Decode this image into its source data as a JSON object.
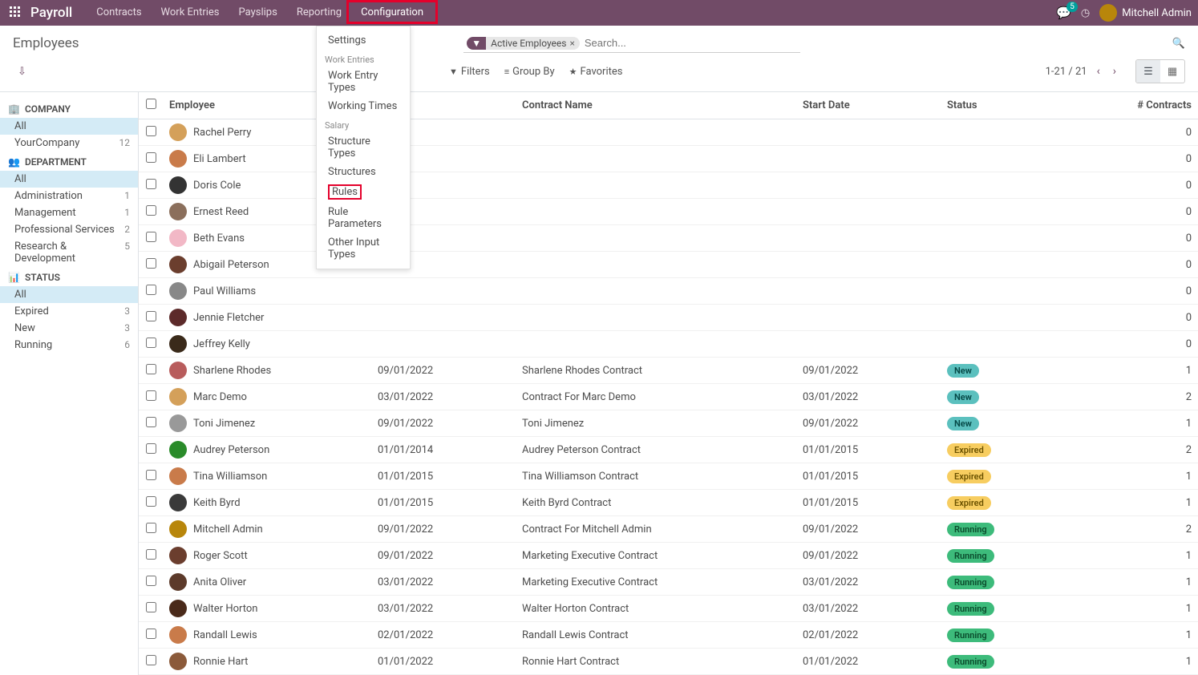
{
  "topnav": {
    "brand": "Payroll",
    "items": [
      "Contracts",
      "Work Entries",
      "Payslips",
      "Reporting",
      "Configuration"
    ],
    "chat_count": "5",
    "user_name": "Mitchell Admin"
  },
  "dropdown": {
    "settings": "Settings",
    "sections": [
      {
        "title": "Work Entries",
        "items": [
          "Work Entry Types",
          "Working Times"
        ]
      },
      {
        "title": "Salary",
        "items": [
          "Structure Types",
          "Structures",
          "Rules",
          "Rule Parameters",
          "Other Input Types"
        ]
      }
    ]
  },
  "breadcrumb": "Employees",
  "search": {
    "facet_label": "Active Employees",
    "placeholder": "Search..."
  },
  "toolbar": {
    "filters": "Filters",
    "group_by": "Group By",
    "favorites": "Favorites",
    "pager": "1-21 / 21"
  },
  "sidebar": {
    "sections": [
      {
        "title": "COMPANY",
        "icon": "🏢",
        "items": [
          {
            "label": "All",
            "count": "",
            "active": true
          },
          {
            "label": "YourCompany",
            "count": "12"
          }
        ]
      },
      {
        "title": "DEPARTMENT",
        "icon": "👥",
        "items": [
          {
            "label": "All",
            "count": "",
            "active": true
          },
          {
            "label": "Administration",
            "count": "1"
          },
          {
            "label": "Management",
            "count": "1"
          },
          {
            "label": "Professional Services",
            "count": "2"
          },
          {
            "label": "Research & Development",
            "count": "5"
          }
        ]
      },
      {
        "title": "STATUS",
        "icon": "📊",
        "items": [
          {
            "label": "All",
            "count": "",
            "active": true
          },
          {
            "label": "Expired",
            "count": "3"
          },
          {
            "label": "New",
            "count": "3"
          },
          {
            "label": "Running",
            "count": "6"
          }
        ]
      }
    ]
  },
  "columns": {
    "employee": "Employee",
    "contract_start": "",
    "contract_name": "Contract Name",
    "start_date": "Start Date",
    "status": "Status",
    "contracts": "# Contracts"
  },
  "rows": [
    {
      "employee": "Rachel Perry",
      "ref": "",
      "contract": "",
      "start": "",
      "status": "",
      "count": "0",
      "avc": "#d4a05a"
    },
    {
      "employee": "Eli Lambert",
      "ref": "",
      "contract": "",
      "start": "",
      "status": "",
      "count": "0",
      "avc": "#c97b4a"
    },
    {
      "employee": "Doris Cole",
      "ref": "",
      "contract": "",
      "start": "",
      "status": "",
      "count": "0",
      "avc": "#333"
    },
    {
      "employee": "Ernest Reed",
      "ref": "",
      "contract": "",
      "start": "",
      "status": "",
      "count": "0",
      "avc": "#8b6f5c"
    },
    {
      "employee": "Beth Evans",
      "ref": "",
      "contract": "",
      "start": "",
      "status": "",
      "count": "0",
      "avc": "#f2b8c6"
    },
    {
      "employee": "Abigail Peterson",
      "ref": "",
      "contract": "",
      "start": "",
      "status": "",
      "count": "0",
      "avc": "#6b3e2e"
    },
    {
      "employee": "Paul Williams",
      "ref": "",
      "contract": "",
      "start": "",
      "status": "",
      "count": "0",
      "avc": "#888"
    },
    {
      "employee": "Jennie Fletcher",
      "ref": "",
      "contract": "",
      "start": "",
      "status": "",
      "count": "0",
      "avc": "#5c2a2a"
    },
    {
      "employee": "Jeffrey Kelly",
      "ref": "",
      "contract": "",
      "start": "",
      "status": "",
      "count": "0",
      "avc": "#3a2a1a"
    },
    {
      "employee": "Sharlene Rhodes",
      "ref": "09/01/2022",
      "contract": "Sharlene Rhodes Contract",
      "start": "09/01/2022",
      "status": "New",
      "count": "1",
      "avc": "#b85c5c"
    },
    {
      "employee": "Marc Demo",
      "ref": "03/01/2022",
      "contract": "Contract For Marc Demo",
      "start": "03/01/2022",
      "status": "New",
      "count": "2",
      "avc": "#d4a05a"
    },
    {
      "employee": "Toni Jimenez",
      "ref": "09/01/2022",
      "contract": "Toni Jimenez",
      "start": "09/01/2022",
      "status": "New",
      "count": "1",
      "avc": "#999"
    },
    {
      "employee": "Audrey Peterson",
      "ref": "01/01/2014",
      "contract": "Audrey Peterson Contract",
      "start": "01/01/2015",
      "status": "Expired",
      "count": "2",
      "avc": "#2a8b2a"
    },
    {
      "employee": "Tina Williamson",
      "ref": "01/01/2015",
      "contract": "Tina Williamson Contract",
      "start": "01/01/2015",
      "status": "Expired",
      "count": "1",
      "avc": "#c97b4a"
    },
    {
      "employee": "Keith Byrd",
      "ref": "01/01/2015",
      "contract": "Keith Byrd Contract",
      "start": "01/01/2015",
      "status": "Expired",
      "count": "1",
      "avc": "#3a3a3a"
    },
    {
      "employee": "Mitchell Admin",
      "ref": "09/01/2022",
      "contract": "Contract For Mitchell Admin",
      "start": "09/01/2022",
      "status": "Running",
      "count": "2",
      "avc": "#b8860b"
    },
    {
      "employee": "Roger Scott",
      "ref": "09/01/2022",
      "contract": "Marketing Executive Contract",
      "start": "09/01/2022",
      "status": "Running",
      "count": "1",
      "avc": "#6b3e2e"
    },
    {
      "employee": "Anita Oliver",
      "ref": "03/01/2022",
      "contract": "Marketing Executive Contract",
      "start": "03/01/2022",
      "status": "Running",
      "count": "1",
      "avc": "#5c3a2a"
    },
    {
      "employee": "Walter Horton",
      "ref": "03/01/2022",
      "contract": "Walter Horton Contract",
      "start": "03/01/2022",
      "status": "Running",
      "count": "1",
      "avc": "#4a2a1a"
    },
    {
      "employee": "Randall Lewis",
      "ref": "02/01/2022",
      "contract": "Randall Lewis Contract",
      "start": "02/01/2022",
      "status": "Running",
      "count": "1",
      "avc": "#c97b4a"
    },
    {
      "employee": "Ronnie Hart",
      "ref": "01/01/2022",
      "contract": "Ronnie Hart Contract",
      "start": "01/01/2022",
      "status": "Running",
      "count": "1",
      "avc": "#8b5a3a"
    }
  ]
}
